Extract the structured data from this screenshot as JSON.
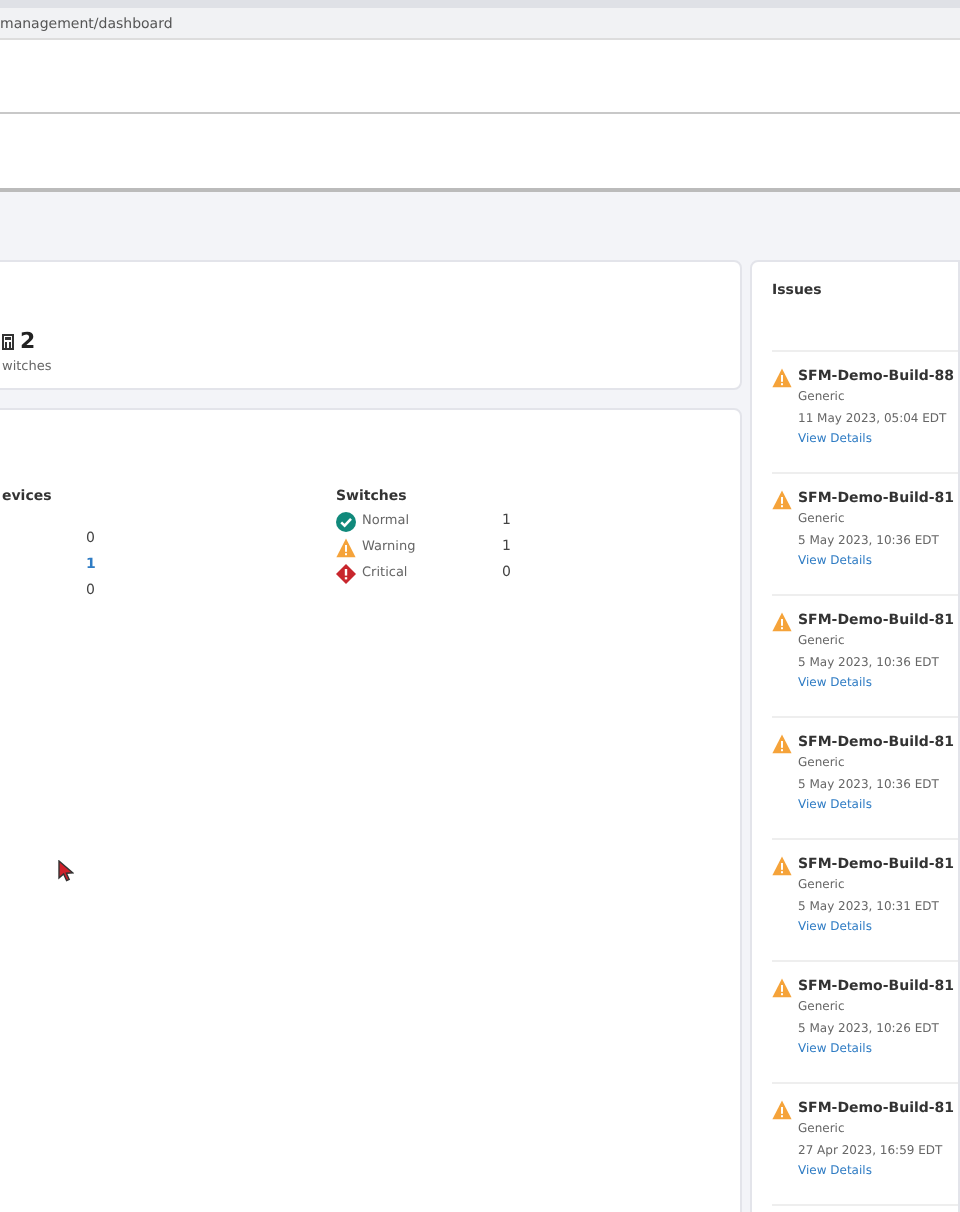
{
  "address_bar": {
    "url": "management/dashboard"
  },
  "summary_card": {
    "count": "2",
    "label": "witches"
  },
  "status_card": {
    "devices": {
      "heading": "evices",
      "rows": [
        {
          "value": "0",
          "link": false
        },
        {
          "value": "1",
          "link": true
        },
        {
          "value": "0",
          "link": false
        }
      ]
    },
    "switches": {
      "heading": "Switches",
      "rows": [
        {
          "kind": "normal",
          "label": "Normal",
          "value": "1"
        },
        {
          "kind": "warning",
          "label": "Warning",
          "value": "1"
        },
        {
          "kind": "critical",
          "label": "Critical",
          "value": "0"
        }
      ]
    }
  },
  "issues": {
    "title": "Issues",
    "items": [
      {
        "kind": "warning",
        "name": "SFM-Demo-Build-88",
        "type": "Generic",
        "time": "11 May 2023, 05:04 EDT",
        "link": "View Details"
      },
      {
        "kind": "warning",
        "name": "SFM-Demo-Build-81",
        "type": "Generic",
        "time": "5 May 2023, 10:36 EDT",
        "link": "View Details"
      },
      {
        "kind": "warning",
        "name": "SFM-Demo-Build-81",
        "type": "Generic",
        "time": "5 May 2023, 10:36 EDT",
        "link": "View Details"
      },
      {
        "kind": "warning",
        "name": "SFM-Demo-Build-81",
        "type": "Generic",
        "time": "5 May 2023, 10:36 EDT",
        "link": "View Details"
      },
      {
        "kind": "warning",
        "name": "SFM-Demo-Build-81",
        "type": "Generic",
        "time": "5 May 2023, 10:31 EDT",
        "link": "View Details"
      },
      {
        "kind": "warning",
        "name": "SFM-Demo-Build-81",
        "type": "Generic",
        "time": "5 May 2023, 10:26 EDT",
        "link": "View Details"
      },
      {
        "kind": "warning",
        "name": "SFM-Demo-Build-81",
        "type": "Generic",
        "time": "27 Apr 2023, 16:59 EDT",
        "link": "View Details"
      }
    ]
  }
}
